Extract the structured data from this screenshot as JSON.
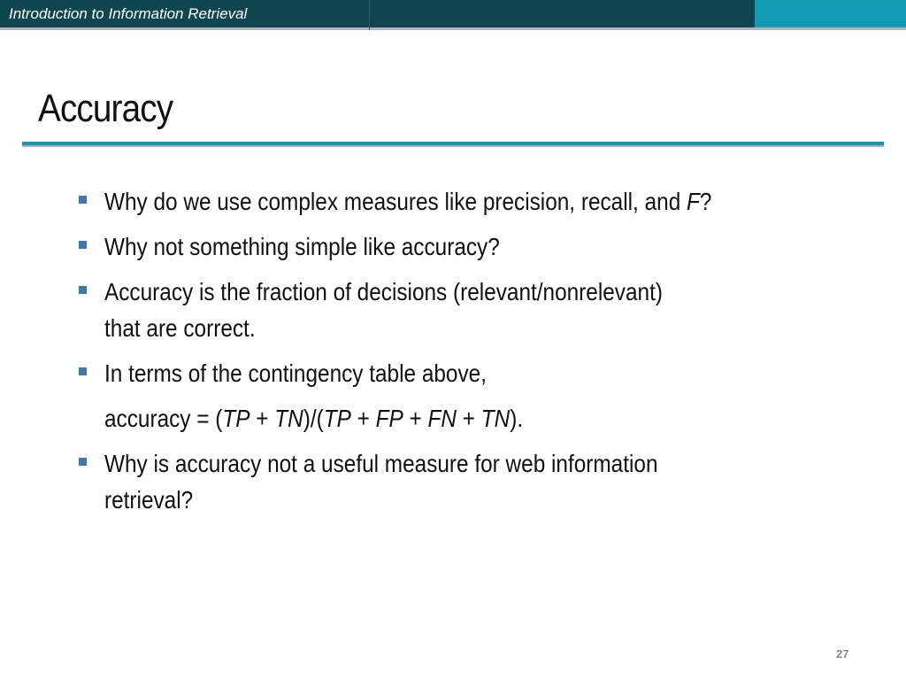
{
  "header": {
    "course_title": "Introduction to Information Retrieval"
  },
  "slide": {
    "title": "Accuracy",
    "bullets": [
      {
        "text_before": "Why do we use complex measures like precision, recall, and ",
        "italic": "F",
        "text_after": "?"
      },
      {
        "text": "Why not something simple like accuracy?"
      },
      {
        "line1": "Accuracy is the fraction of decisions (relevant/nonrelevant)",
        "line2": "that are correct."
      },
      {
        "text": "In terms of the contingency table above,"
      },
      {
        "formula": {
          "p1": "accuracy = (",
          "tp": "TP",
          "p2": " + ",
          "tn": "TN",
          "p3": ")/(",
          "tp2": "TP",
          "p4": " + ",
          "fp": "FP",
          "p5": " + ",
          "fn": "FN",
          "p6": " + ",
          "tn2": "TN",
          "p7": ")."
        }
      },
      {
        "line1": "Why is accuracy not a useful measure for web information",
        "line2": "retrieval?"
      }
    ],
    "page_number": "27"
  },
  "colors": {
    "header_dark": "#10464f",
    "header_light": "#139bb5",
    "bullet": "#3d78b0",
    "rule": "#1897af"
  }
}
